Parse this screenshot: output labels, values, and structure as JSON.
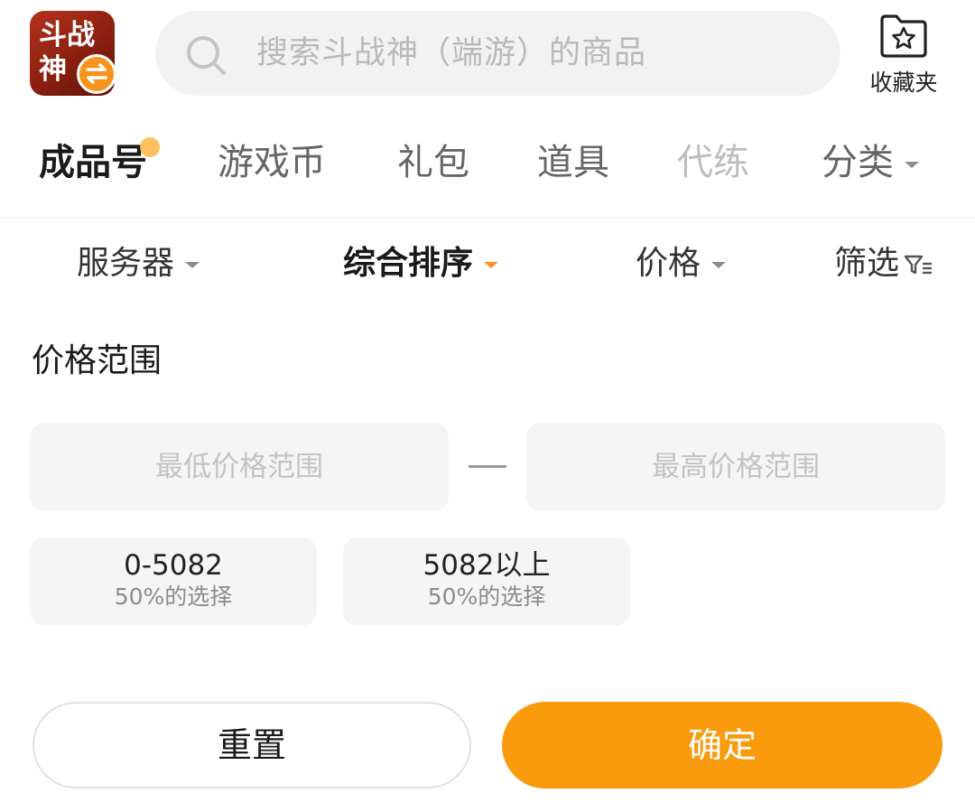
{
  "header": {
    "app_icon_text": "斗战神",
    "search_placeholder": "搜索斗战神（端游）的商品",
    "favorites_label": "收藏夹"
  },
  "tabs": [
    {
      "label": "成品号",
      "active": true
    },
    {
      "label": "游戏币"
    },
    {
      "label": "礼包"
    },
    {
      "label": "道具"
    },
    {
      "label": "代练"
    },
    {
      "label": "分类"
    }
  ],
  "sortbar": {
    "server": "服务器",
    "sort": "综合排序",
    "price": "价格",
    "filter": "筛选"
  },
  "price_panel": {
    "title": "价格范围",
    "min_placeholder": "最低价格范围",
    "max_placeholder": "最高价格范围",
    "chips": [
      {
        "value": "0-5082",
        "sub": "50%的选择"
      },
      {
        "value": "5082以上",
        "sub": "50%的选择"
      }
    ]
  },
  "actions": {
    "reset": "重置",
    "confirm": "确定"
  },
  "colors": {
    "accent": "#f99b0d",
    "app_icon_bg": "#8a1f10",
    "input_bg": "#f5f5f5"
  }
}
